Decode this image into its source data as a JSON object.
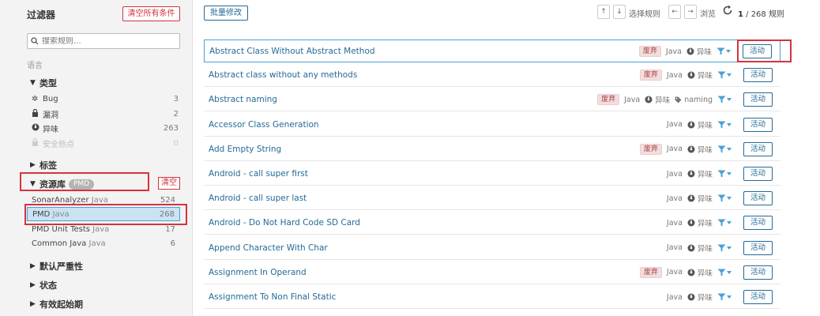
{
  "sidebar": {
    "title": "过滤器",
    "clear_all_label": "清空所有条件",
    "search_placeholder": "搜索规则...",
    "language_label": "语言",
    "type_facet": {
      "label": "类型",
      "items": [
        {
          "label": "Bug",
          "count": "3",
          "icon": "bug-icon"
        },
        {
          "label": "漏洞",
          "count": "2",
          "icon": "lock-icon"
        },
        {
          "label": "异味",
          "count": "263",
          "icon": "smell-icon"
        },
        {
          "label": "安全热点",
          "count": "0",
          "icon": "hotspot-icon"
        }
      ]
    },
    "tag_facet_label": "标签",
    "repo_facet": {
      "label": "资源库",
      "badge": "PMD",
      "clear_label": "清空",
      "items": [
        {
          "label": "SonarAnalyzer",
          "sub": "Java",
          "count": "524"
        },
        {
          "label": "PMD",
          "sub": "Java",
          "count": "268"
        },
        {
          "label": "PMD Unit Tests",
          "sub": "Java",
          "count": "17"
        },
        {
          "label": "Common Java",
          "sub": "Java",
          "count": "6"
        }
      ]
    },
    "severity_facet_label": "默认严重性",
    "status_facet_label": "状态",
    "available_since_label": "有效起始期"
  },
  "toolbar": {
    "bulk_change_label": "批量修改",
    "select_rule_label": "选择规则",
    "browse_label": "浏览",
    "count_current": "1",
    "count_total": " / 268 规则"
  },
  "rules": [
    {
      "name": "Abstract Class Without Abstract Method",
      "deprecated": "废弃",
      "lang": "Java",
      "type": "异味",
      "tag": "",
      "action": "活动"
    },
    {
      "name": "Abstract class without any methods",
      "deprecated": "废弃",
      "lang": "Java",
      "type": "异味",
      "tag": "",
      "action": "活动"
    },
    {
      "name": "Abstract naming",
      "deprecated": "废弃",
      "lang": "Java",
      "type": "异味",
      "tag": "naming",
      "action": "活动"
    },
    {
      "name": "Accessor Class Generation",
      "deprecated": "",
      "lang": "Java",
      "type": "异味",
      "tag": "",
      "action": "活动"
    },
    {
      "name": "Add Empty String",
      "deprecated": "废弃",
      "lang": "Java",
      "type": "异味",
      "tag": "",
      "action": "活动"
    },
    {
      "name": "Android - call super first",
      "deprecated": "",
      "lang": "Java",
      "type": "异味",
      "tag": "",
      "action": "活动"
    },
    {
      "name": "Android - call super last",
      "deprecated": "",
      "lang": "Java",
      "type": "异味",
      "tag": "",
      "action": "活动"
    },
    {
      "name": "Android - Do Not Hard Code SD Card",
      "deprecated": "",
      "lang": "Java",
      "type": "异味",
      "tag": "",
      "action": "活动"
    },
    {
      "name": "Append Character With Char",
      "deprecated": "",
      "lang": "Java",
      "type": "异味",
      "tag": "",
      "action": "活动"
    },
    {
      "name": "Assignment In Operand",
      "deprecated": "废弃",
      "lang": "Java",
      "type": "异味",
      "tag": "",
      "action": "活动"
    },
    {
      "name": "Assignment To Non Final Static",
      "deprecated": "",
      "lang": "Java",
      "type": "异味",
      "tag": "",
      "action": "活动"
    }
  ],
  "colors": {
    "accent": "#236a97",
    "danger": "#d4333f",
    "selected_bg": "#cae3f2"
  }
}
